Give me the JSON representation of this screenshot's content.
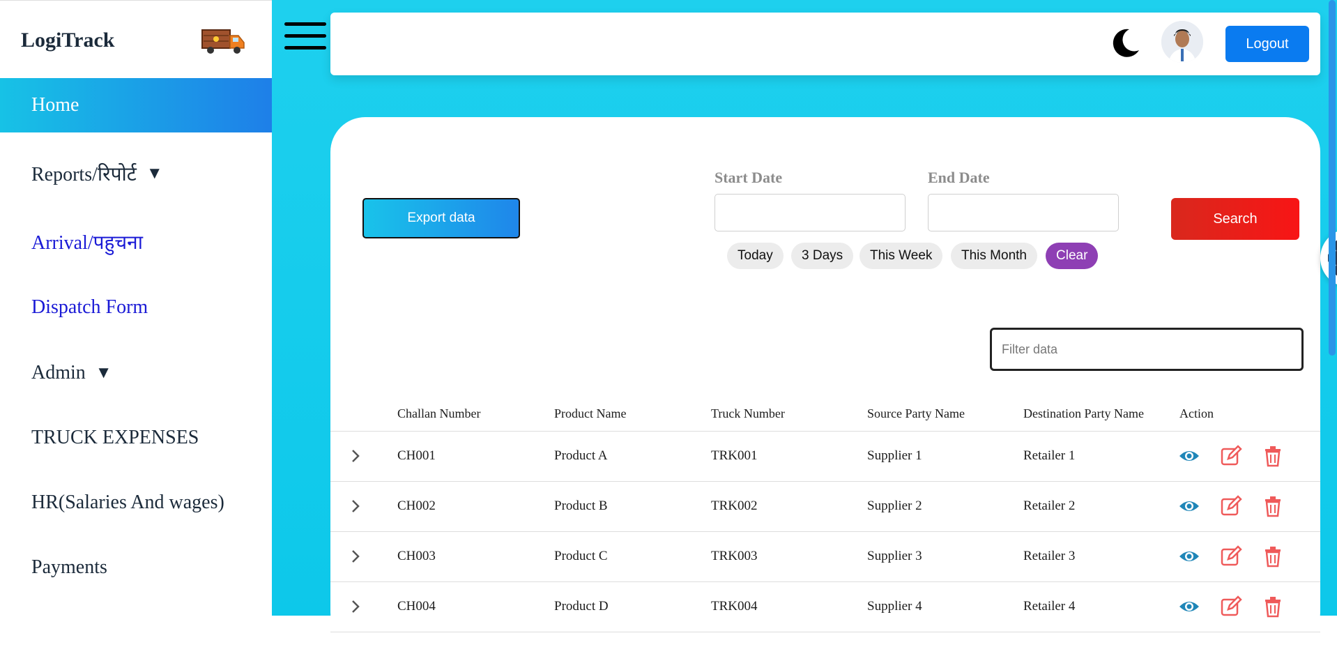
{
  "app": {
    "brand": "LogiTrack"
  },
  "sidebar": {
    "items": [
      {
        "label": "Home"
      },
      {
        "label": "Reports/रिपोर्ट",
        "caret": "▼"
      },
      {
        "label": "Arrival/पहुचना"
      },
      {
        "label": "Dispatch Form"
      },
      {
        "label": "Admin",
        "caret": "▼"
      },
      {
        "label": "TRUCK EXPENSES"
      },
      {
        "label": "HR(Salaries And wages)"
      },
      {
        "label": "Payments"
      }
    ]
  },
  "header": {
    "logout_label": "Logout",
    "theme_icon": "moon-icon"
  },
  "toolbar": {
    "export_label": "Export data",
    "start_date_label": "Start Date",
    "end_date_label": "End Date",
    "start_date_value": "",
    "end_date_value": "",
    "search_label": "Search",
    "quick_ranges": [
      "Today",
      "3 Days",
      "This Week",
      "This Month",
      "Clear"
    ],
    "filter_placeholder": "Filter data"
  },
  "table": {
    "columns": [
      "Challan Number",
      "Product Name",
      "Truck Number",
      "Source Party Name",
      "Destination Party Name",
      "Action"
    ],
    "rows": [
      [
        "CH001",
        "Product A",
        "TRK001",
        "Supplier 1",
        "Retailer 1"
      ],
      [
        "CH002",
        "Product B",
        "TRK002",
        "Supplier 2",
        "Retailer 2"
      ],
      [
        "CH003",
        "Product C",
        "TRK003",
        "Supplier 3",
        "Retailer 3"
      ],
      [
        "CH004",
        "Product D",
        "TRK004",
        "Supplier 4",
        "Retailer 4"
      ]
    ]
  },
  "colors": {
    "accent": "#17c2e6",
    "view_icon": "#1f86b8",
    "edit_icon": "#ef5a5a",
    "delete_icon": "#ef5a5a",
    "clear_chip": "#8e3fb4"
  }
}
